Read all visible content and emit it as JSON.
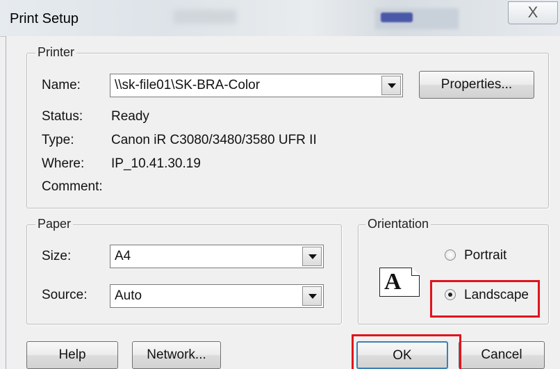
{
  "window": {
    "title": "Print Setup",
    "close_glyph": "X"
  },
  "printer": {
    "group_label": "Printer",
    "name_label": "Name:",
    "name_value": "\\\\sk-file01\\SK-BRA-Color",
    "properties_button": "Properties...",
    "status_label": "Status:",
    "status_value": "Ready",
    "type_label": "Type:",
    "type_value": "Canon iR C3080/3480/3580 UFR II",
    "where_label": "Where:",
    "where_value": "IP_10.41.30.19",
    "comment_label": "Comment:",
    "comment_value": ""
  },
  "paper": {
    "group_label": "Paper",
    "size_label": "Size:",
    "size_value": "A4",
    "source_label": "Source:",
    "source_value": "Auto"
  },
  "orientation": {
    "group_label": "Orientation",
    "icon_letter": "A",
    "portrait_label": "Portrait",
    "landscape_label": "Landscape",
    "selected": "Landscape"
  },
  "buttons": {
    "help": "Help",
    "network": "Network...",
    "ok": "OK",
    "cancel": "Cancel"
  },
  "highlight_color": "#e0141c"
}
